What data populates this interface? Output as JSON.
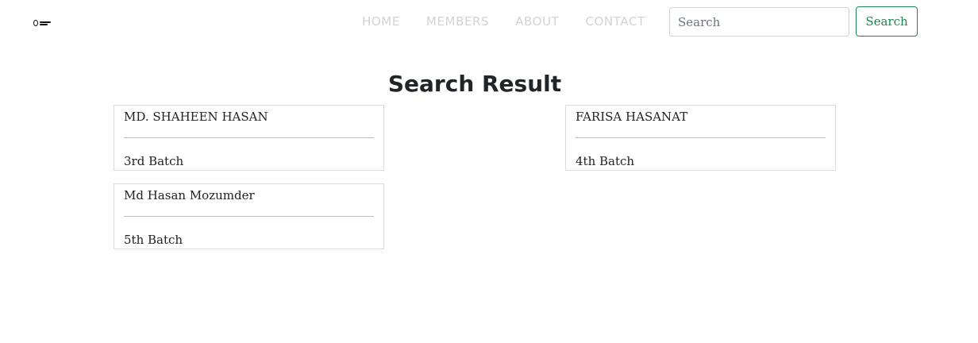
{
  "nav": {
    "logo_name": "logo-icon",
    "links": [
      {
        "label": "HOME"
      },
      {
        "label": "MEMBERS"
      },
      {
        "label": "ABOUT"
      },
      {
        "label": "CONTACT"
      }
    ],
    "search": {
      "placeholder": "Search",
      "value": "",
      "button_label": "Search"
    }
  },
  "main": {
    "title": "Search Result",
    "results": [
      {
        "name": "MD. SHAHEEN HASAN",
        "batch": "3rd Batch"
      },
      {
        "name": "FARISA HASANAT",
        "batch": "4th Batch"
      },
      {
        "name": "Md Hasan Mozumder",
        "batch": "5th Batch"
      }
    ]
  },
  "colors": {
    "accent": "#198754",
    "nav_link": "#d3d3d3",
    "card_border": "#dcdcdc"
  }
}
